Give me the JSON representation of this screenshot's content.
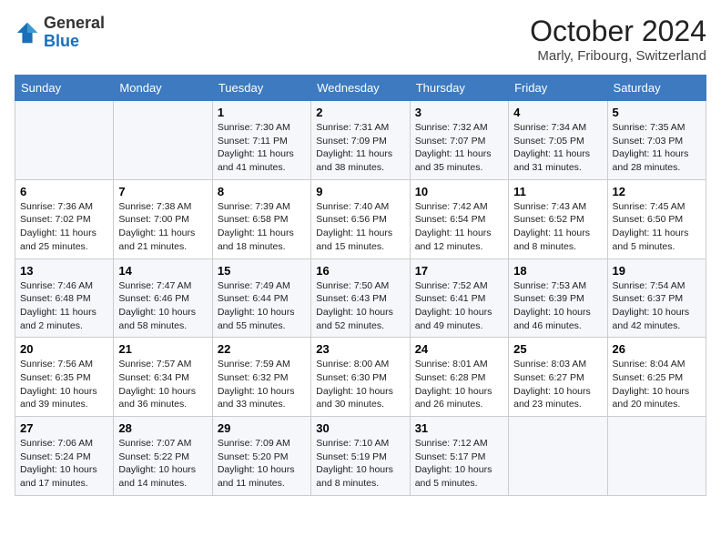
{
  "header": {
    "logo_general": "General",
    "logo_blue": "Blue",
    "month_title": "October 2024",
    "location": "Marly, Fribourg, Switzerland"
  },
  "weekdays": [
    "Sunday",
    "Monday",
    "Tuesday",
    "Wednesday",
    "Thursday",
    "Friday",
    "Saturday"
  ],
  "weeks": [
    [
      {
        "day": "",
        "info": ""
      },
      {
        "day": "",
        "info": ""
      },
      {
        "day": "1",
        "info": "Sunrise: 7:30 AM\nSunset: 7:11 PM\nDaylight: 11 hours and 41 minutes."
      },
      {
        "day": "2",
        "info": "Sunrise: 7:31 AM\nSunset: 7:09 PM\nDaylight: 11 hours and 38 minutes."
      },
      {
        "day": "3",
        "info": "Sunrise: 7:32 AM\nSunset: 7:07 PM\nDaylight: 11 hours and 35 minutes."
      },
      {
        "day": "4",
        "info": "Sunrise: 7:34 AM\nSunset: 7:05 PM\nDaylight: 11 hours and 31 minutes."
      },
      {
        "day": "5",
        "info": "Sunrise: 7:35 AM\nSunset: 7:03 PM\nDaylight: 11 hours and 28 minutes."
      }
    ],
    [
      {
        "day": "6",
        "info": "Sunrise: 7:36 AM\nSunset: 7:02 PM\nDaylight: 11 hours and 25 minutes."
      },
      {
        "day": "7",
        "info": "Sunrise: 7:38 AM\nSunset: 7:00 PM\nDaylight: 11 hours and 21 minutes."
      },
      {
        "day": "8",
        "info": "Sunrise: 7:39 AM\nSunset: 6:58 PM\nDaylight: 11 hours and 18 minutes."
      },
      {
        "day": "9",
        "info": "Sunrise: 7:40 AM\nSunset: 6:56 PM\nDaylight: 11 hours and 15 minutes."
      },
      {
        "day": "10",
        "info": "Sunrise: 7:42 AM\nSunset: 6:54 PM\nDaylight: 11 hours and 12 minutes."
      },
      {
        "day": "11",
        "info": "Sunrise: 7:43 AM\nSunset: 6:52 PM\nDaylight: 11 hours and 8 minutes."
      },
      {
        "day": "12",
        "info": "Sunrise: 7:45 AM\nSunset: 6:50 PM\nDaylight: 11 hours and 5 minutes."
      }
    ],
    [
      {
        "day": "13",
        "info": "Sunrise: 7:46 AM\nSunset: 6:48 PM\nDaylight: 11 hours and 2 minutes."
      },
      {
        "day": "14",
        "info": "Sunrise: 7:47 AM\nSunset: 6:46 PM\nDaylight: 10 hours and 58 minutes."
      },
      {
        "day": "15",
        "info": "Sunrise: 7:49 AM\nSunset: 6:44 PM\nDaylight: 10 hours and 55 minutes."
      },
      {
        "day": "16",
        "info": "Sunrise: 7:50 AM\nSunset: 6:43 PM\nDaylight: 10 hours and 52 minutes."
      },
      {
        "day": "17",
        "info": "Sunrise: 7:52 AM\nSunset: 6:41 PM\nDaylight: 10 hours and 49 minutes."
      },
      {
        "day": "18",
        "info": "Sunrise: 7:53 AM\nSunset: 6:39 PM\nDaylight: 10 hours and 46 minutes."
      },
      {
        "day": "19",
        "info": "Sunrise: 7:54 AM\nSunset: 6:37 PM\nDaylight: 10 hours and 42 minutes."
      }
    ],
    [
      {
        "day": "20",
        "info": "Sunrise: 7:56 AM\nSunset: 6:35 PM\nDaylight: 10 hours and 39 minutes."
      },
      {
        "day": "21",
        "info": "Sunrise: 7:57 AM\nSunset: 6:34 PM\nDaylight: 10 hours and 36 minutes."
      },
      {
        "day": "22",
        "info": "Sunrise: 7:59 AM\nSunset: 6:32 PM\nDaylight: 10 hours and 33 minutes."
      },
      {
        "day": "23",
        "info": "Sunrise: 8:00 AM\nSunset: 6:30 PM\nDaylight: 10 hours and 30 minutes."
      },
      {
        "day": "24",
        "info": "Sunrise: 8:01 AM\nSunset: 6:28 PM\nDaylight: 10 hours and 26 minutes."
      },
      {
        "day": "25",
        "info": "Sunrise: 8:03 AM\nSunset: 6:27 PM\nDaylight: 10 hours and 23 minutes."
      },
      {
        "day": "26",
        "info": "Sunrise: 8:04 AM\nSunset: 6:25 PM\nDaylight: 10 hours and 20 minutes."
      }
    ],
    [
      {
        "day": "27",
        "info": "Sunrise: 7:06 AM\nSunset: 5:24 PM\nDaylight: 10 hours and 17 minutes."
      },
      {
        "day": "28",
        "info": "Sunrise: 7:07 AM\nSunset: 5:22 PM\nDaylight: 10 hours and 14 minutes."
      },
      {
        "day": "29",
        "info": "Sunrise: 7:09 AM\nSunset: 5:20 PM\nDaylight: 10 hours and 11 minutes."
      },
      {
        "day": "30",
        "info": "Sunrise: 7:10 AM\nSunset: 5:19 PM\nDaylight: 10 hours and 8 minutes."
      },
      {
        "day": "31",
        "info": "Sunrise: 7:12 AM\nSunset: 5:17 PM\nDaylight: 10 hours and 5 minutes."
      },
      {
        "day": "",
        "info": ""
      },
      {
        "day": "",
        "info": ""
      }
    ]
  ]
}
